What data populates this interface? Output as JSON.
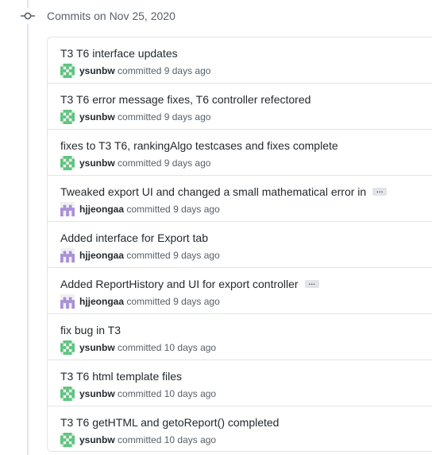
{
  "group": {
    "title": "Commits on Nov 25, 2020"
  },
  "commits": [
    {
      "title": "T3 T6 interface updates",
      "author": "ysunbw",
      "avatar": "green-identicon",
      "verb": "committed",
      "when": "9 days ago",
      "has_ellipsis": false
    },
    {
      "title": "T3 T6 error message fixes, T6 controller refectored",
      "author": "ysunbw",
      "avatar": "green-identicon",
      "verb": "committed",
      "when": "9 days ago",
      "has_ellipsis": false
    },
    {
      "title": "fixes to T3 T6, rankingAlgo testcases and fixes complete",
      "author": "ysunbw",
      "avatar": "green-identicon",
      "verb": "committed",
      "when": "9 days ago",
      "has_ellipsis": false
    },
    {
      "title": "Tweaked export UI and changed a small mathematical error in",
      "author": "hjjeongaa",
      "avatar": "purple-identicon",
      "verb": "committed",
      "when": "9 days ago",
      "has_ellipsis": true,
      "ellipsis": "…"
    },
    {
      "title": "Added interface for Export tab",
      "author": "hjjeongaa",
      "avatar": "purple-identicon",
      "verb": "committed",
      "when": "9 days ago",
      "has_ellipsis": false
    },
    {
      "title": "Added ReportHistory and UI for export controller",
      "author": "hjjeongaa",
      "avatar": "purple-identicon",
      "verb": "committed",
      "when": "9 days ago",
      "has_ellipsis": true,
      "ellipsis": "…"
    },
    {
      "title": "fix bug in T3",
      "author": "ysunbw",
      "avatar": "green-identicon",
      "verb": "committed",
      "when": "10 days ago",
      "has_ellipsis": false
    },
    {
      "title": "T3 T6 html template files",
      "author": "ysunbw",
      "avatar": "green-identicon",
      "verb": "committed",
      "when": "10 days ago",
      "has_ellipsis": false
    },
    {
      "title": "T3 T6 getHTML and getoReport() completed",
      "author": "ysunbw",
      "avatar": "green-identicon",
      "verb": "committed",
      "when": "10 days ago",
      "has_ellipsis": false
    }
  ],
  "colors": {
    "green_avatar": "#5cc47e",
    "purple_avatar": "#a88ed6"
  }
}
